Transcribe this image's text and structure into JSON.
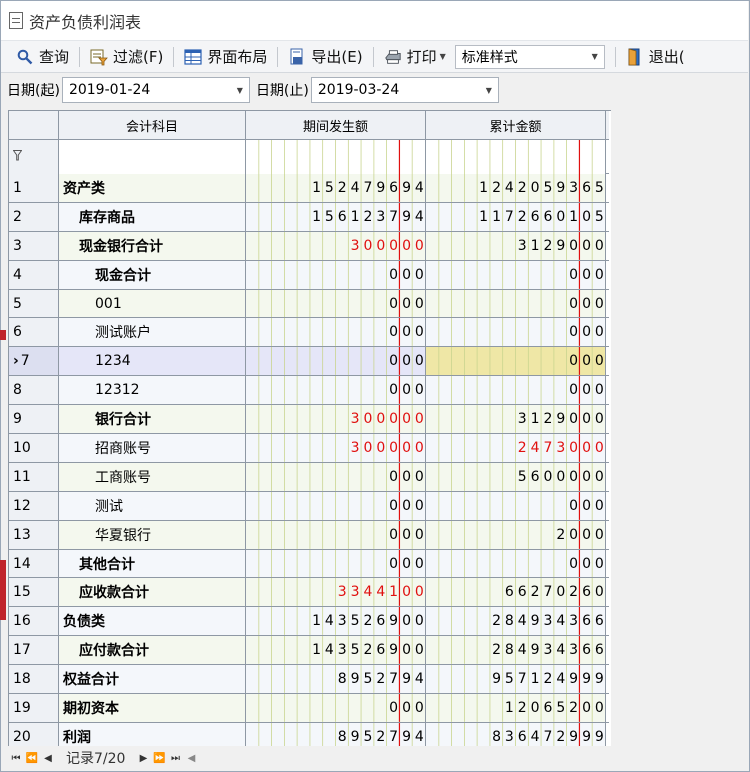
{
  "window": {
    "title": "资产负债利润表"
  },
  "toolbar": {
    "query_label": "查询",
    "filter_label": "过滤(F)",
    "layout_label": "界面布局",
    "export_label": "导出(E)",
    "print_label": "打印",
    "style_value": "标准样式",
    "exit_label": "退出("
  },
  "dates": {
    "start_label": "日期(起)",
    "start_value": "2019-01-24",
    "end_label": "日期(止)",
    "end_value": "2019-03-24"
  },
  "table": {
    "headers": [
      "会计科目",
      "期间发生额",
      "累计金额"
    ],
    "rows": [
      {
        "no": "1",
        "name": "资产类",
        "indent": 0,
        "bold": true,
        "period": "152479694",
        "period_neg": false,
        "cum": "124205936 5",
        "cum_neg": false
      },
      {
        "no": "2",
        "name": "库存商品",
        "indent": 1,
        "bold": true,
        "period": "156123794",
        "period_neg": false,
        "cum": "1172660105",
        "cum_neg": false
      },
      {
        "no": "3",
        "name": "现金银行合计",
        "indent": 1,
        "bold": true,
        "period": "300000",
        "period_neg": true,
        "cum": "3129000",
        "cum_neg": false
      },
      {
        "no": "4",
        "name": "现金合计",
        "indent": 2,
        "bold": true,
        "period": "000",
        "period_neg": false,
        "cum": "000",
        "cum_neg": false
      },
      {
        "no": "5",
        "name": "001",
        "indent": 2,
        "bold": false,
        "period": "000",
        "period_neg": false,
        "cum": "000",
        "cum_neg": false
      },
      {
        "no": "6",
        "name": "测试账户",
        "indent": 2,
        "bold": false,
        "period": "000",
        "period_neg": false,
        "cum": "000",
        "cum_neg": false
      },
      {
        "no": "7",
        "name": "1234",
        "indent": 2,
        "bold": false,
        "period": "000",
        "period_neg": false,
        "cum": "000",
        "cum_neg": false,
        "selected": true
      },
      {
        "no": "8",
        "name": "12312",
        "indent": 2,
        "bold": false,
        "period": "000",
        "period_neg": false,
        "cum": "000",
        "cum_neg": false
      },
      {
        "no": "9",
        "name": "银行合计",
        "indent": 2,
        "bold": true,
        "period": "300000",
        "period_neg": true,
        "cum": "3129000",
        "cum_neg": false
      },
      {
        "no": "10",
        "name": "招商账号",
        "indent": 2,
        "bold": false,
        "period": "300000",
        "period_neg": true,
        "cum": "2473000",
        "cum_neg": true
      },
      {
        "no": "11",
        "name": "工商账号",
        "indent": 2,
        "bold": false,
        "period": "000",
        "period_neg": false,
        "cum": "5600000",
        "cum_neg": false
      },
      {
        "no": "12",
        "name": "测试",
        "indent": 2,
        "bold": false,
        "period": "000",
        "period_neg": false,
        "cum": "000",
        "cum_neg": false
      },
      {
        "no": "13",
        "name": "华夏银行",
        "indent": 2,
        "bold": false,
        "period": "000",
        "period_neg": false,
        "cum": "2000",
        "cum_neg": false
      },
      {
        "no": "14",
        "name": "其他合计",
        "indent": 1,
        "bold": true,
        "period": "000",
        "period_neg": false,
        "cum": "000",
        "cum_neg": false
      },
      {
        "no": "15",
        "name": "应收款合计",
        "indent": 1,
        "bold": true,
        "period": "3344100",
        "period_neg": true,
        "cum": "66270260",
        "cum_neg": false
      },
      {
        "no": "16",
        "name": "负债类",
        "indent": 0,
        "bold": true,
        "period": "143526900",
        "period_neg": false,
        "cum": "284934366",
        "cum_neg": false
      },
      {
        "no": "17",
        "name": "应付款合计",
        "indent": 1,
        "bold": true,
        "period": "143526900",
        "period_neg": false,
        "cum": "284934366",
        "cum_neg": false
      },
      {
        "no": "18",
        "name": "权益合计",
        "indent": 0,
        "bold": true,
        "period": "8952794",
        "period_neg": false,
        "cum": "957124999",
        "cum_neg": false
      },
      {
        "no": "19",
        "name": "期初资本",
        "indent": 0,
        "bold": true,
        "period": "000",
        "period_neg": false,
        "cum": "12065200",
        "cum_neg": false
      },
      {
        "no": "20",
        "name": "利润",
        "indent": 0,
        "bold": true,
        "period": "8952794",
        "period_neg": false,
        "cum": "836472999",
        "cum_neg": false
      }
    ]
  },
  "pager": {
    "record_label": "记录7/20"
  },
  "colors": {
    "negative": "#e0100f",
    "decimal_line": "#e0100f",
    "selection": "#efe7a6"
  },
  "icons": [
    "document-icon",
    "search-icon",
    "filter-icon",
    "layout-icon",
    "export-icon",
    "print-icon",
    "exit-icon",
    "funnel-icon"
  ]
}
